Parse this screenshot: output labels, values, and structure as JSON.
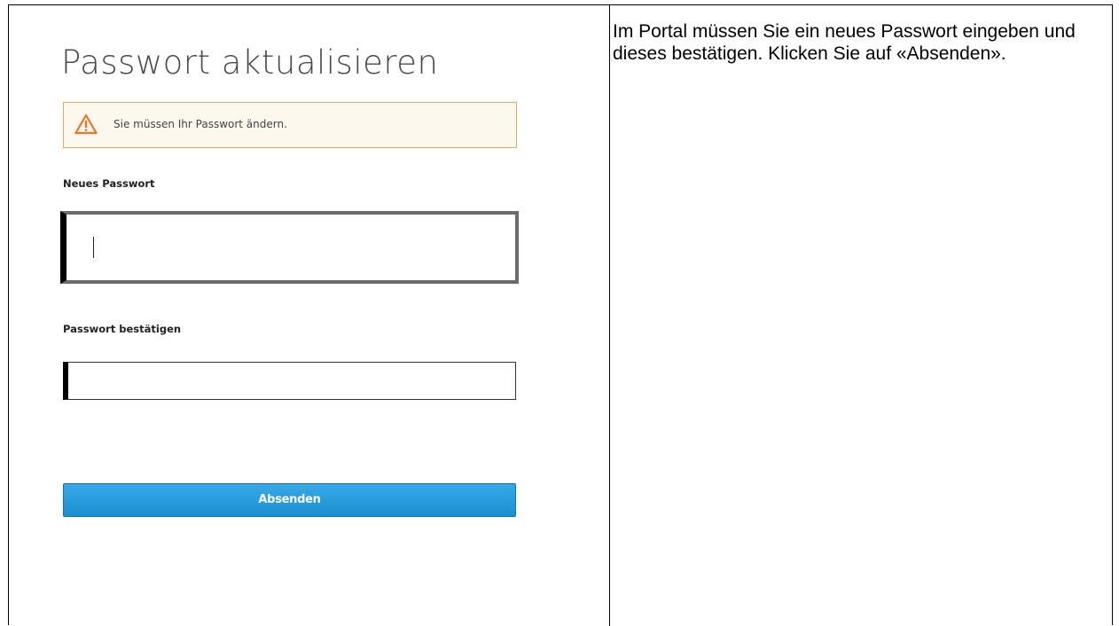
{
  "form": {
    "title": "Passwort aktualisieren",
    "alert": {
      "icon": "warning-icon",
      "message": "Sie müssen Ihr Passwort ändern.",
      "border_color": "#e8a869",
      "icon_color": "#e8752a"
    },
    "new_password": {
      "label": "Neues Passwort",
      "value": ""
    },
    "confirm_password": {
      "label": "Passwort bestätigen",
      "value": ""
    },
    "submit_label": "Absenden",
    "button_color": "#1a8fd0"
  },
  "instructions": {
    "text": "Im Portal müssen Sie ein neues Passwort eingeben und dieses bestätigen. Klicken Sie auf «Absenden»."
  }
}
